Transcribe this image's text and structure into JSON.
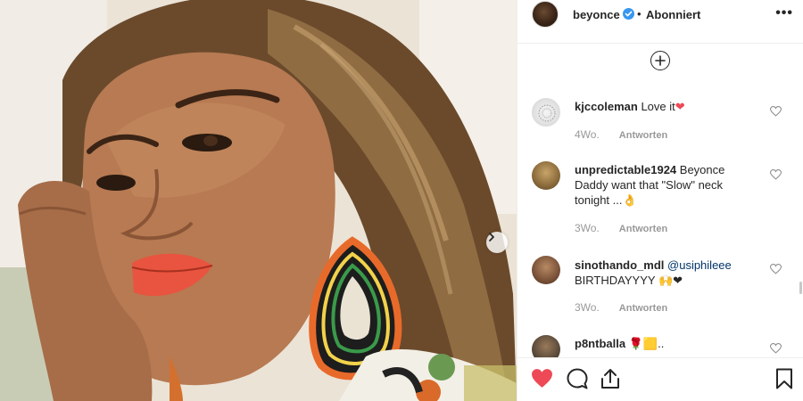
{
  "post": {
    "username": "beyonce",
    "separator": "•",
    "follow_status": "Abonniert",
    "more_label": "•••"
  },
  "comments": [
    {
      "username": "kjccoleman",
      "text": "Love it",
      "emoji": "❤",
      "age": "4Wo.",
      "reply": "Antworten"
    },
    {
      "username": "unpredictable1924",
      "text": "Beyonce Daddy want that \"Slow\" neck tonight ...",
      "emoji": "👌",
      "age": "3Wo.",
      "reply": "Antworten"
    },
    {
      "username": "sinothando_mdl",
      "mention": "@usiphileee",
      "text": "BIRTHDAYYYY",
      "emoji": "🙌❤",
      "age": "3Wo.",
      "reply": "Antworten"
    },
    {
      "username": "p8ntballa",
      "text": "..",
      "emoji": "🌹🟨"
    }
  ],
  "icons": {
    "load_more": "plus-circle-icon",
    "next": "chevron-right-icon",
    "like": "heart-filled-icon",
    "comment": "comment-bubble-icon",
    "share": "share-icon",
    "save": "bookmark-icon"
  },
  "colors": {
    "like_red": "#ed4956",
    "verified_blue": "#3897f0",
    "meta_gray": "#999999"
  }
}
